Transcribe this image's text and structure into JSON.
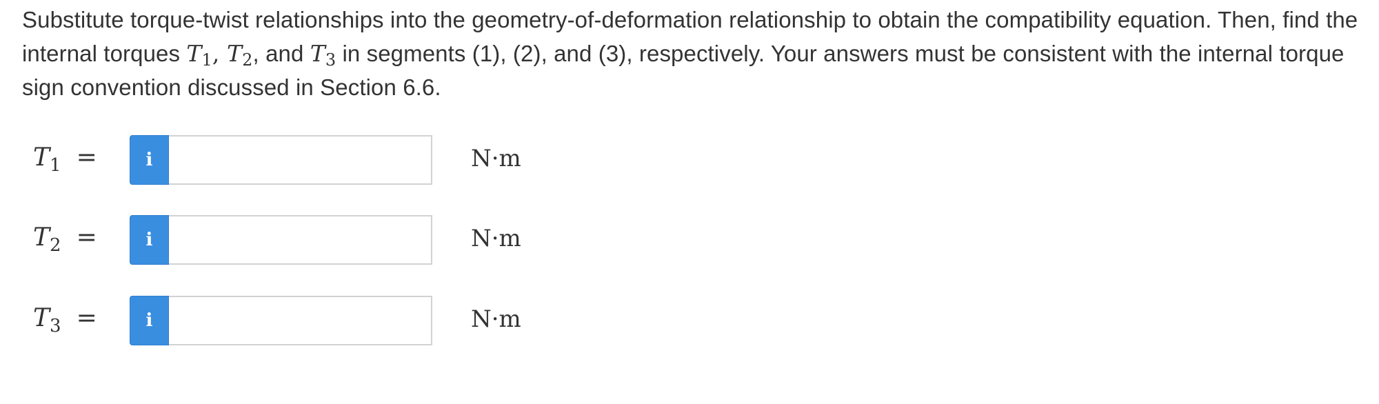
{
  "prompt": {
    "part1": "Substitute torque-twist relationships into the geometry-of-deformation relationship to obtain the compatibility equation.  Then, find the internal torques ",
    "t1_var": "T",
    "t1_sub": "1",
    "comma1": ", ",
    "t2_var": "T",
    "t2_sub": "2",
    "and_text": ", and ",
    "t3_var": "T",
    "t3_sub": "3",
    "part2": " in segments (1), (2), and (3), respectively.  Your answers must be consistent with the internal torque sign convention discussed in Section 6.6."
  },
  "answers": [
    {
      "var": "T",
      "sub": "1",
      "eq": "=",
      "info_icon": "i",
      "value": "",
      "unit": "N·m"
    },
    {
      "var": "T",
      "sub": "2",
      "eq": "=",
      "info_icon": "i",
      "value": "",
      "unit": "N·m"
    },
    {
      "var": "T",
      "sub": "3",
      "eq": "=",
      "info_icon": "i",
      "value": "",
      "unit": "N·m"
    }
  ],
  "colors": {
    "info_button": "#3a8ee0",
    "text": "#333333",
    "input_border": "#d2d2d2"
  }
}
